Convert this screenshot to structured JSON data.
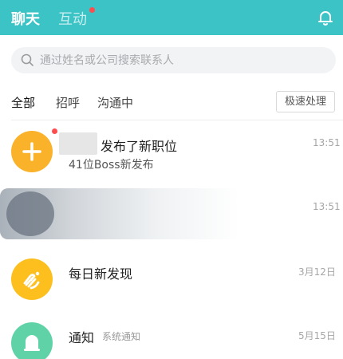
{
  "header": {
    "tab_chat": "聊天",
    "tab_interact": "互动"
  },
  "search": {
    "placeholder": "通过姓名或公司搜索联系人"
  },
  "filters": {
    "all": "全部",
    "greeting": "招呼",
    "communicating": "沟通中",
    "fast_process": "极速处理"
  },
  "messages": [
    {
      "title": "发布了新职位",
      "subtitle": "41位Boss新发布",
      "time": "13:51",
      "icon": "plus-icon",
      "unread": true
    },
    {
      "time": "13:51",
      "blurred": true
    },
    {
      "title": "每日新发现",
      "time": "3月12日",
      "icon": "hand-heart-icon"
    },
    {
      "title": "通知",
      "tag": "系统通知",
      "time": "5月15日",
      "icon": "bell-icon"
    }
  ],
  "colors": {
    "header": "#3cc3c5",
    "badge": "#ff4d4f",
    "orange": "#fbb22b",
    "yellow": "#fcbf1e",
    "green": "#5fd3a7"
  }
}
